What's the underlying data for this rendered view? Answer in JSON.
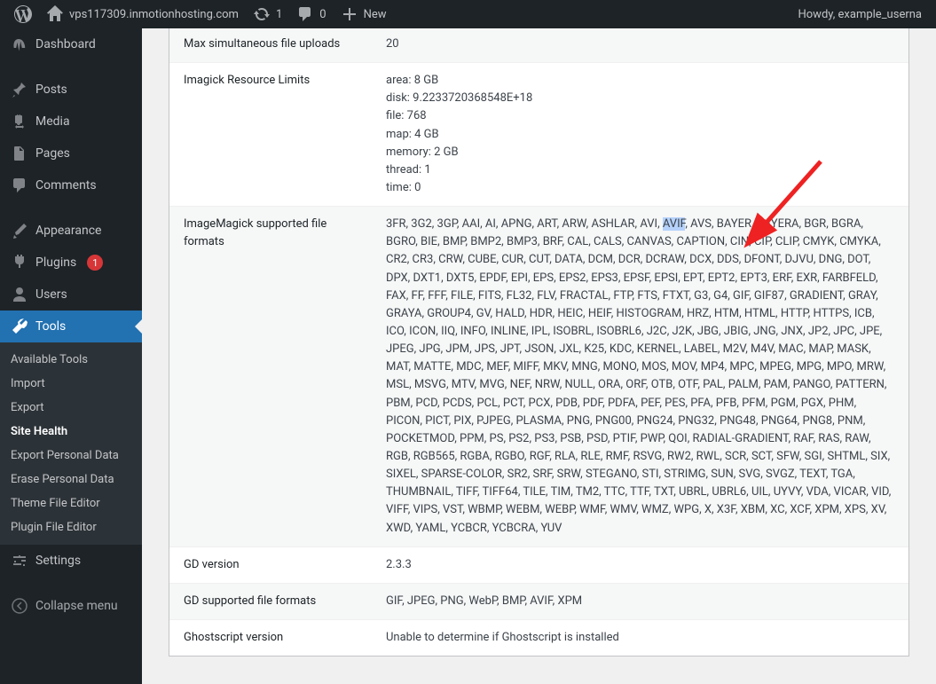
{
  "adminbar": {
    "site": "vps117309.inmotionhosting.com",
    "updates": "1",
    "comments": "0",
    "new": "New",
    "howdy": "Howdy, example_userna"
  },
  "sidebar": {
    "dashboard": "Dashboard",
    "posts": "Posts",
    "media": "Media",
    "pages": "Pages",
    "comments": "Comments",
    "appearance": "Appearance",
    "plugins": "Plugins",
    "plugins_badge": "1",
    "users": "Users",
    "tools": "Tools",
    "settings": "Settings",
    "collapse": "Collapse menu",
    "submenu": {
      "available": "Available Tools",
      "import": "Import",
      "export": "Export",
      "sitehealth": "Site Health",
      "exportpd": "Export Personal Data",
      "erasepd": "Erase Personal Data",
      "themefile": "Theme File Editor",
      "pluginfile": "Plugin File Editor"
    }
  },
  "rows": {
    "maxupload_label": "Max simultaneous file uploads",
    "maxupload_value": "20",
    "imagick_limits_label": "Imagick Resource Limits",
    "imagick_limits_value": "area: 8 GB\ndisk: 9.2233720368548E+18\nfile: 768\nmap: 4 GB\nmemory: 2 GB\nthread: 1\ntime: 0",
    "imagick_formats_label": "ImageMagick supported file formats",
    "imagick_formats_before": "3FR, 3G2, 3GP, AAI, AI, APNG, ART, ARW, ASHLAR, AVI, ",
    "imagick_formats_highlight": "AVIF",
    "imagick_formats_after": ", AVS, BAYER, BAYERA, BGR, BGRA, BGRO, BIE, BMP, BMP2, BMP3, BRF, CAL, CALS, CANVAS, CAPTION, CIN, CIP, CLIP, CMYK, CMYKA, CR2, CR3, CRW, CUBE, CUR, CUT, DATA, DCM, DCR, DCRAW, DCX, DDS, DFONT, DJVU, DNG, DOT, DPX, DXT1, DXT5, EPDF, EPI, EPS, EPS2, EPS3, EPSF, EPSI, EPT, EPT2, EPT3, ERF, EXR, FARBFELD, FAX, FF, FFF, FILE, FITS, FL32, FLV, FRACTAL, FTP, FTS, FTXT, G3, G4, GIF, GIF87, GRADIENT, GRAY, GRAYA, GROUP4, GV, HALD, HDR, HEIC, HEIF, HISTOGRAM, HRZ, HTM, HTML, HTTP, HTTPS, ICB, ICO, ICON, IIQ, INFO, INLINE, IPL, ISOBRL, ISOBRL6, J2C, J2K, JBG, JBIG, JNG, JNX, JP2, JPC, JPE, JPEG, JPG, JPM, JPS, JPT, JSON, JXL, K25, KDC, KERNEL, LABEL, M2V, M4V, MAC, MAP, MASK, MAT, MATTE, MDC, MEF, MIFF, MKV, MNG, MONO, MOS, MOV, MP4, MPC, MPEG, MPG, MPO, MRW, MSL, MSVG, MTV, MVG, NEF, NRW, NULL, ORA, ORF, OTB, OTF, PAL, PALM, PAM, PANGO, PATTERN, PBM, PCD, PCDS, PCL, PCT, PCX, PDB, PDF, PDFA, PEF, PES, PFA, PFB, PFM, PGM, PGX, PHM, PICON, PICT, PIX, PJPEG, PLASMA, PNG, PNG00, PNG24, PNG32, PNG48, PNG64, PNG8, PNM, POCKETMOD, PPM, PS, PS2, PS3, PSB, PSD, PTIF, PWP, QOI, RADIAL-GRADIENT, RAF, RAS, RAW, RGB, RGB565, RGBA, RGBO, RGF, RLA, RLE, RMF, RSVG, RW2, RWL, SCR, SCT, SFW, SGI, SHTML, SIX, SIXEL, SPARSE-COLOR, SR2, SRF, SRW, STEGANO, STI, STRIMG, SUN, SVG, SVGZ, TEXT, TGA, THUMBNAIL, TIFF, TIFF64, TILE, TIM, TM2, TTC, TTF, TXT, UBRL, UBRL6, UIL, UYVY, VDA, VICAR, VID, VIFF, VIPS, VST, WBMP, WEBM, WEBP, WMF, WMV, WMZ, WPG, X, X3F, XBM, XC, XCF, XPM, XPS, XV, XWD, YAML, YCBCR, YCBCRA, YUV",
    "gdver_label": "GD version",
    "gdver_value": "2.3.3",
    "gdformats_label": "GD supported file formats",
    "gdformats_value": "GIF, JPEG, PNG, WebP, BMP, AVIF, XPM",
    "gs_label": "Ghostscript version",
    "gs_value": "Unable to determine if Ghostscript is installed"
  }
}
